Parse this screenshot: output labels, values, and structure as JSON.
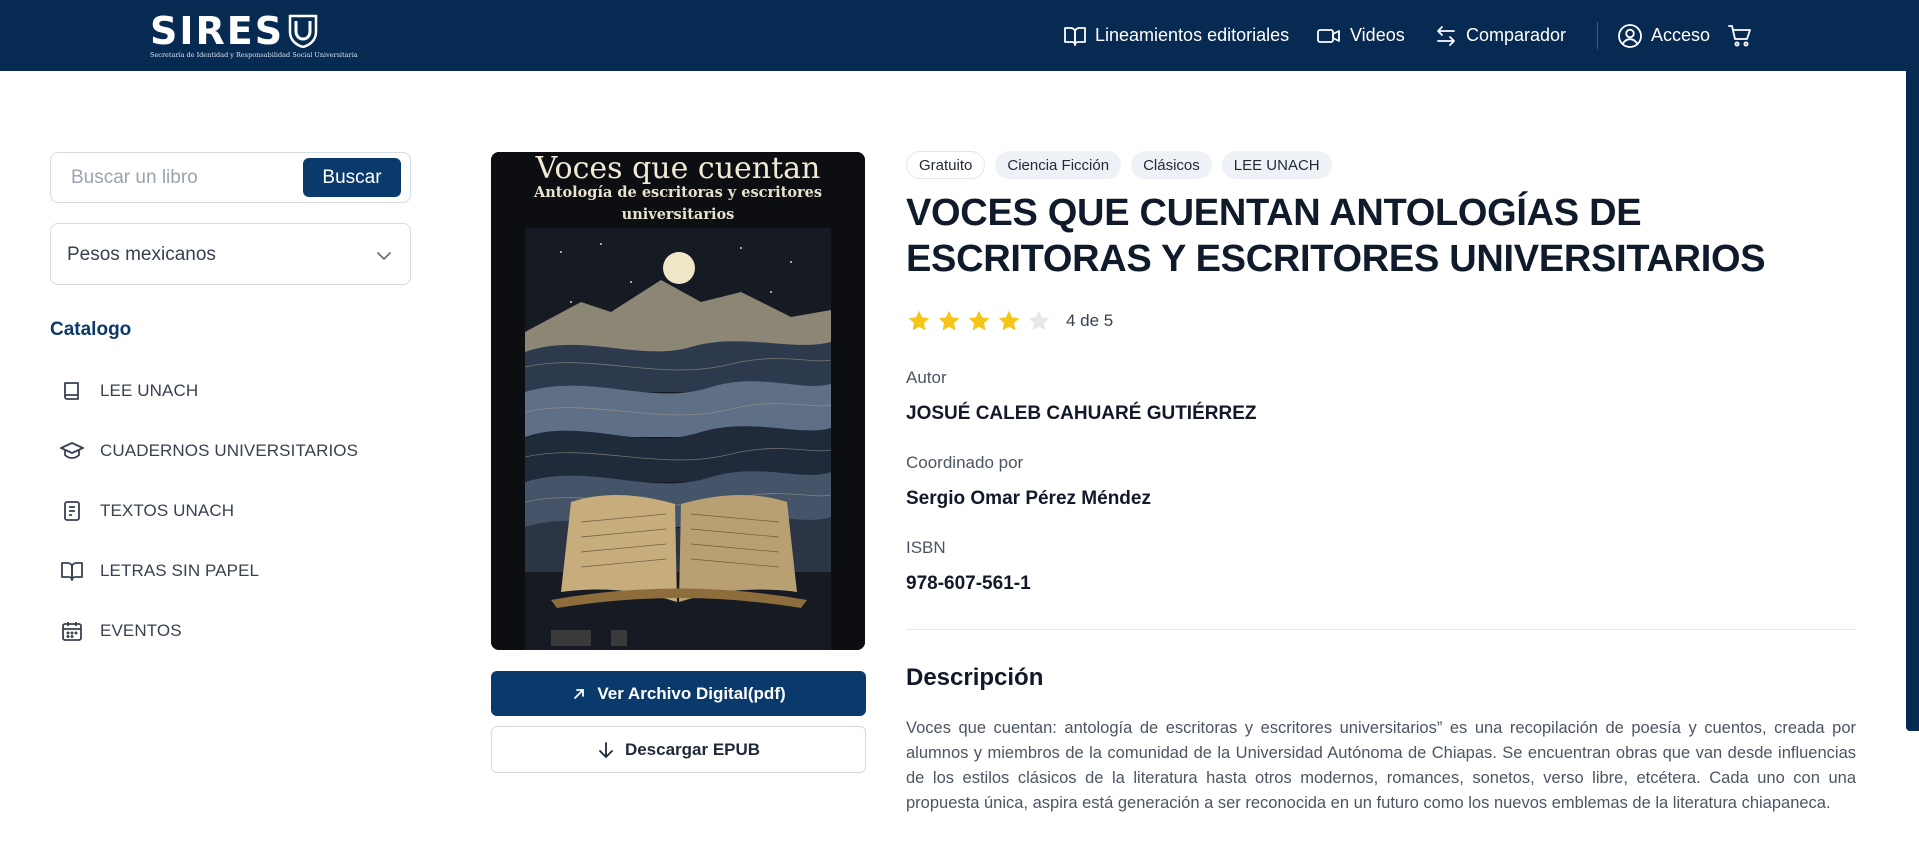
{
  "header": {
    "logo_text": "SIRES",
    "logo_subtitle": "Secretaría de Identidad y Responsabilidad Social Universitaria",
    "nav": [
      {
        "label": "Lineamientos editoriales",
        "icon": "book-open-icon"
      },
      {
        "label": "Videos",
        "icon": "video-icon"
      },
      {
        "label": "Comparador",
        "icon": "arrows-swap-icon"
      },
      {
        "label": "Acceso",
        "icon": "user-circle-icon"
      }
    ],
    "cart_icon": "cart-icon"
  },
  "sidebar": {
    "search": {
      "placeholder": "Buscar un libro",
      "button_label": "Buscar"
    },
    "currency": {
      "selected": "Pesos mexicanos"
    },
    "catalog_title": "Catalogo",
    "items": [
      {
        "label": "LEE UNACH",
        "icon": "book-icon"
      },
      {
        "label": "CUADERNOS UNIVERSITARIOS",
        "icon": "graduation-cap-icon"
      },
      {
        "label": "TEXTOS UNACH",
        "icon": "document-icon"
      },
      {
        "label": "LETRAS SIN PAPEL",
        "icon": "open-book-icon"
      },
      {
        "label": "EVENTOS",
        "icon": "calendar-icon"
      }
    ]
  },
  "book": {
    "cover_title": "Voces que cuentan",
    "cover_subtitle": "Antología de escritoras y escritores universitarios",
    "buttons": {
      "pdf": "Ver Archivo Digital(pdf)",
      "epub": "Descargar EPUB"
    },
    "tags": [
      "Gratuito",
      "Ciencia Ficción",
      "Clásicos",
      "LEE UNACH"
    ],
    "title": "VOCES QUE CUENTAN ANTOLOGÍAS DE ESCRITORAS Y ESCRITORES UNIVERSITARIOS",
    "rating": {
      "value": 4,
      "max": 5,
      "text": "4 de 5",
      "star_color": "#f5c518"
    },
    "author_label": "Autor",
    "author": "JOSUÉ CALEB CAHUARÉ GUTIÉRREZ",
    "coordinator_label": "Coordinado por",
    "coordinator": "Sergio Omar Pérez Méndez",
    "isbn_label": "ISBN",
    "isbn": "978-607-561-1",
    "description_title": "Descripción",
    "description": "Voces que cuentan: antología de escritoras y escritores universitarios” es una recopilación de poesía y cuentos, creada por alumnos y miembros de la comunidad de la Universidad Autónoma de Chiapas. Se encuentran obras que van desde influencias de los estilos clásicos de la literatura hasta otros modernos, romances, sonetos, verso libre, etcétera. Cada uno con una propuesta única, aspira está generación a ser reconocida en un futuro como los nuevos emblemas de la literatura chiapaneca."
  },
  "colors": {
    "primary": "#072a52",
    "button": "#0a3a6c"
  }
}
